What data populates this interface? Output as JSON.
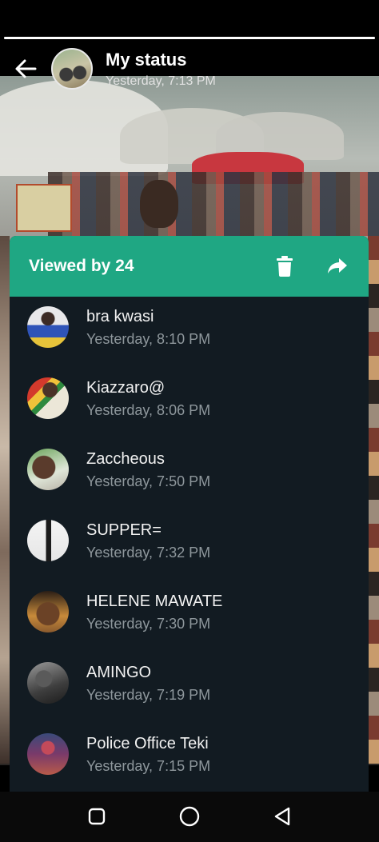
{
  "status_progress": 1.0,
  "header": {
    "title": "My status",
    "subtitle": "Yesterday, 7:13 PM"
  },
  "panel": {
    "title": "Viewed by 24"
  },
  "viewers": [
    {
      "name": "bra kwasi",
      "time": "Yesterday, 8:10 PM"
    },
    {
      "name": "Kiazzaro@",
      "time": "Yesterday, 8:06 PM"
    },
    {
      "name": "Zaccheous",
      "time": "Yesterday, 7:50 PM"
    },
    {
      "name": "SUPPER=",
      "time": "Yesterday, 7:32 PM"
    },
    {
      "name": "HELENE MAWATE",
      "time": "Yesterday, 7:30 PM"
    },
    {
      "name": "AMINGO",
      "time": "Yesterday, 7:19 PM"
    },
    {
      "name": "Police Office Teki",
      "time": "Yesterday, 7:15 PM"
    }
  ],
  "icons": {
    "back": "arrow-back-icon",
    "delete": "trash-icon",
    "forward": "share-forward-icon",
    "nav_recents": "square-icon",
    "nav_home": "circle-icon",
    "nav_back": "triangle-back-icon"
  },
  "colors": {
    "accent": "#1fa783",
    "panel_bg": "#121b22",
    "time_text": "#8e979c"
  }
}
